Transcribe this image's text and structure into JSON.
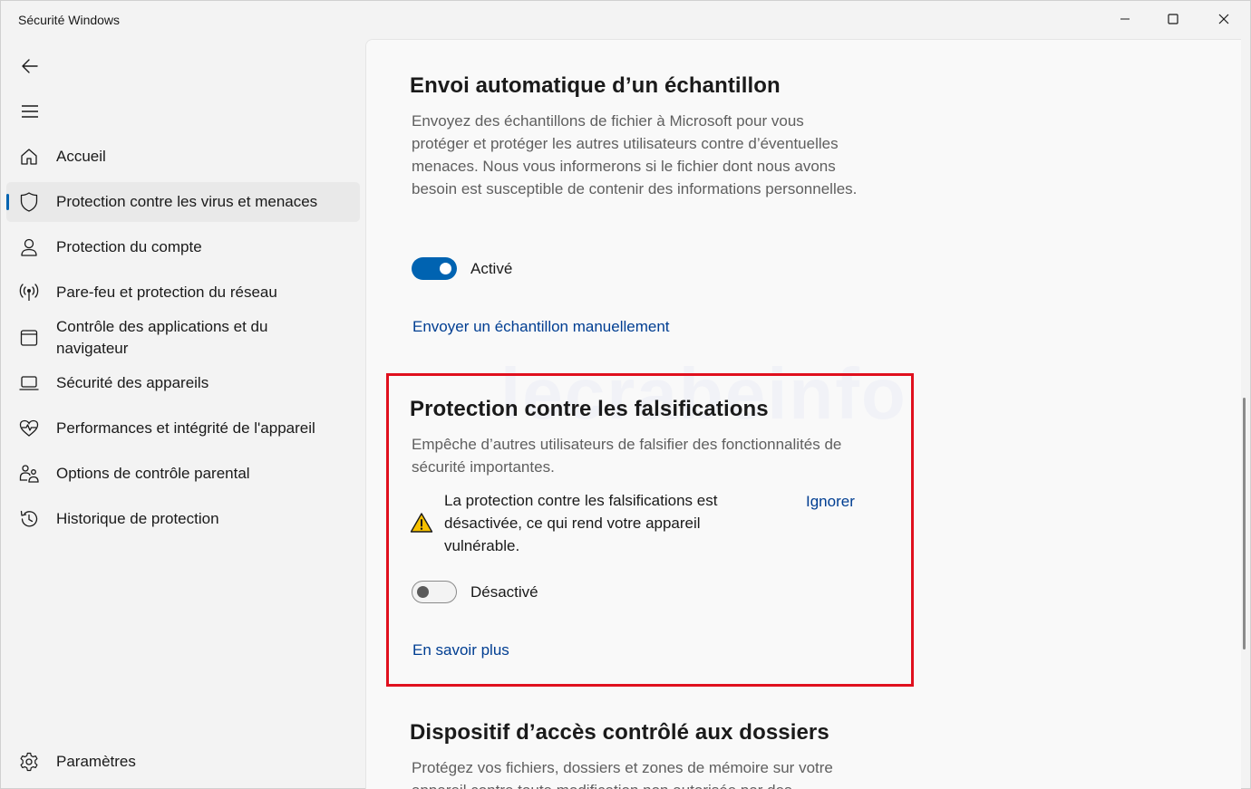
{
  "window": {
    "title": "Sécurité Windows"
  },
  "sidebar": {
    "items": [
      {
        "label": "Accueil",
        "icon": "home-icon"
      },
      {
        "label": "Protection contre les virus et menaces",
        "icon": "shield-icon",
        "active": true
      },
      {
        "label": "Protection du compte",
        "icon": "person-icon"
      },
      {
        "label": "Pare-feu et protection du réseau",
        "icon": "wifi-antenna-icon"
      },
      {
        "label": "Contrôle des applications et du navigateur",
        "icon": "browser-window-icon"
      },
      {
        "label": "Sécurité des appareils",
        "icon": "laptop-icon"
      },
      {
        "label": "Performances et intégrité de l'appareil",
        "icon": "heart-pulse-icon"
      },
      {
        "label": "Options de contrôle parental",
        "icon": "family-icon"
      },
      {
        "label": "Historique de protection",
        "icon": "history-icon"
      }
    ],
    "settings_label": "Paramètres"
  },
  "sample": {
    "title": "Envoi automatique d’un échantillon",
    "description": "Envoyez des échantillons de fichier à Microsoft pour vous protéger et protéger les autres utilisateurs contre d’éventuelles menaces. Nous vous informerons si le fichier dont nous avons besoin est susceptible de contenir des informations personnelles.",
    "toggle_state": "on",
    "toggle_label": "Activé",
    "manual_link": "Envoyer un échantillon manuellement"
  },
  "tamper": {
    "title": "Protection contre les falsifications",
    "description": "Empêche d’autres utilisateurs de falsifier des fonctionnalités de sécurité importantes.",
    "warning": "La protection contre les falsifications est désactivée, ce qui rend votre appareil vulnérable.",
    "dismiss_label": "Ignorer",
    "toggle_state": "off",
    "toggle_label": "Désactivé",
    "learn_more": "En savoir plus"
  },
  "folder_access": {
    "title": "Dispositif d’accès contrôlé aux dossiers",
    "description": "Protégez vos fichiers, dossiers et zones de mémoire sur votre appareil contre toute modification non autorisée par des"
  },
  "watermark": "lecrabeinfo",
  "colors": {
    "accent": "#0063b1",
    "link": "#003e92",
    "highlight": "#e0101e",
    "warning": "#f5c000"
  }
}
